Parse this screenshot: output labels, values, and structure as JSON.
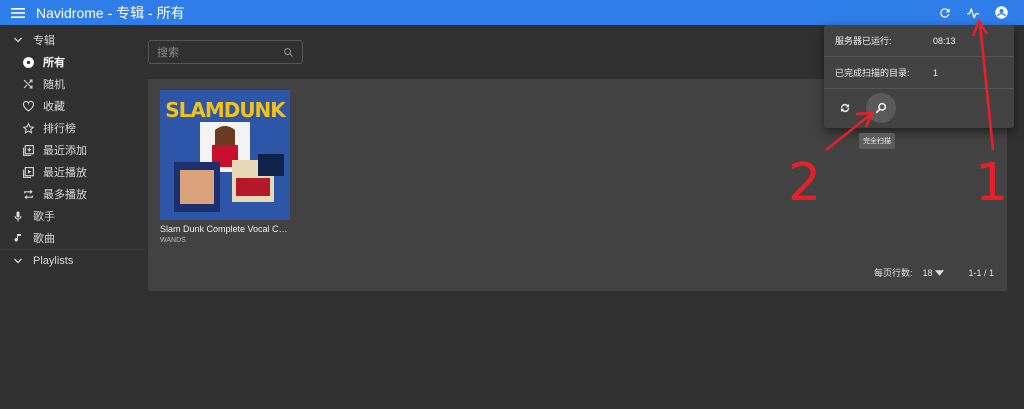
{
  "appbar": {
    "title": "Navidrome - 专辑 - 所有",
    "icons": [
      "menu-icon",
      "refresh-icon",
      "activity-icon",
      "account-icon"
    ]
  },
  "sidebar": {
    "albums_section": "专辑",
    "items": [
      {
        "label": "所有",
        "icon": "disc-icon",
        "active": true
      },
      {
        "label": "随机",
        "icon": "shuffle-icon",
        "active": false
      },
      {
        "label": "收藏",
        "icon": "heart-icon",
        "active": false
      },
      {
        "label": "排行榜",
        "icon": "star-icon",
        "active": false
      },
      {
        "label": "最近添加",
        "icon": "library-add-icon",
        "active": false
      },
      {
        "label": "最近播放",
        "icon": "video-library-icon",
        "active": false
      },
      {
        "label": "最多播放",
        "icon": "repeat-icon",
        "active": false
      }
    ],
    "artists": "歌手",
    "songs": "歌曲",
    "playlists": "Playlists"
  },
  "search": {
    "placeholder": "搜索"
  },
  "album": {
    "title": "Slam Dunk Complete Vocal Col...",
    "artist": "WANDS",
    "cover_text": "SLAMDUNK"
  },
  "pagination": {
    "rows_per_page_label": "每页行数:",
    "rows_per_page": "18",
    "range": "1-1 / 1"
  },
  "activity_panel": {
    "uptime_label": "服务器已运行:",
    "uptime_value": "08:13",
    "scanned_label": "已完成扫描的目录:",
    "scanned_value": "1",
    "full_scan_tooltip": "完全扫描"
  },
  "annotations": {
    "label_1": "1",
    "label_2": "2",
    "color": "#e5202a"
  },
  "colors": {
    "appbar": "#2f7de8",
    "background": "#303030",
    "card": "#424242"
  }
}
